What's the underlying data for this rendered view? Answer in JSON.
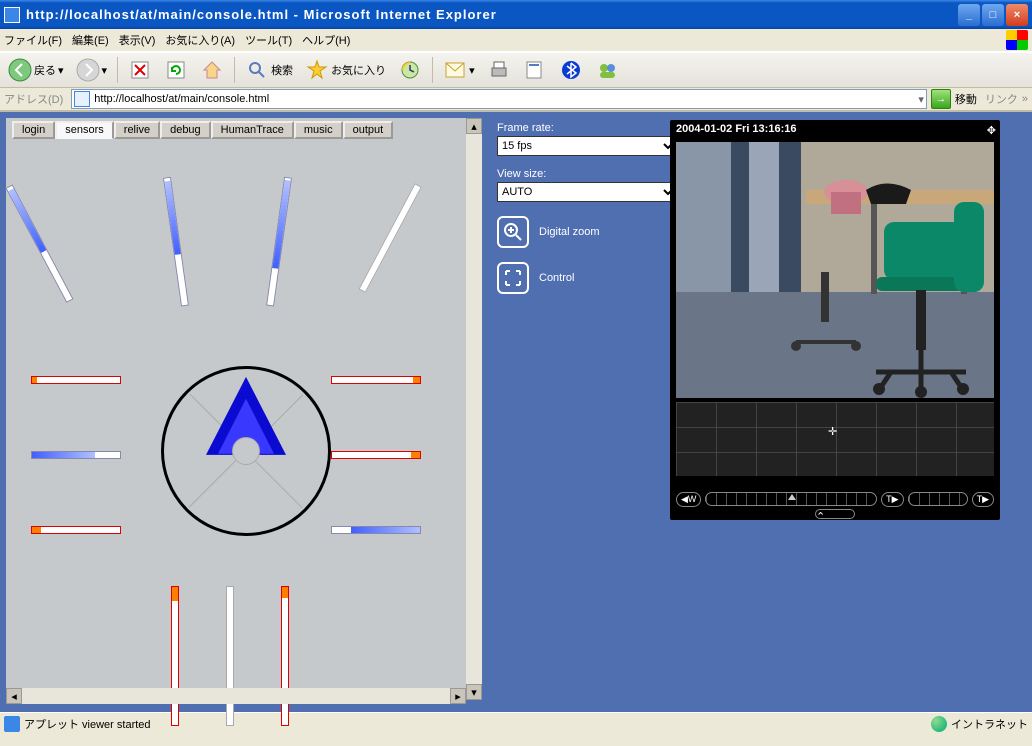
{
  "window": {
    "title": "http://localhost/at/main/console.html - Microsoft Internet Explorer"
  },
  "menu": {
    "file": "ファイル(F)",
    "edit": "編集(E)",
    "view": "表示(V)",
    "fav": "お気に入り(A)",
    "tools": "ツール(T)",
    "help": "ヘルプ(H)"
  },
  "toolbar": {
    "back": "戻る",
    "search": "検索",
    "favorites": "お気に入り"
  },
  "address": {
    "label": "アドレス(D)",
    "url": "http://localhost/at/main/console.html",
    "go": "移動",
    "links": "リンク"
  },
  "tabs": [
    "login",
    "sensors",
    "relive",
    "debug",
    "HumanTrace",
    "music",
    "output"
  ],
  "active_tab": 1,
  "controls": {
    "frame_rate_label": "Frame rate:",
    "frame_rate_value": "15 fps",
    "view_size_label": "View size:",
    "view_size_value": "AUTO",
    "digital_zoom": "Digital zoom",
    "control": "Control"
  },
  "camera": {
    "timestamp": "2004-01-02 Fri 13:16:16",
    "wide": "◀W",
    "tele": "T▶"
  },
  "status": {
    "text": "アプレット viewer started",
    "zone": "イントラネット"
  }
}
